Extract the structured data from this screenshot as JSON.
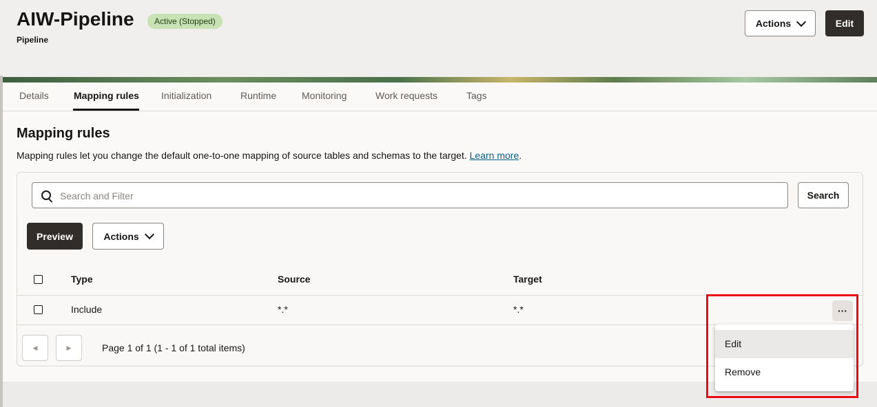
{
  "header": {
    "title": "AIW-Pipeline",
    "status_badge": "Active (Stopped)",
    "subtitle": "Pipeline",
    "actions_label": "Actions",
    "edit_label": "Edit"
  },
  "tabs": [
    {
      "label": "Details"
    },
    {
      "label": "Mapping rules",
      "active": true
    },
    {
      "label": "Initialization"
    },
    {
      "label": "Runtime"
    },
    {
      "label": "Monitoring"
    },
    {
      "label": "Work requests"
    },
    {
      "label": "Tags"
    }
  ],
  "section": {
    "title": "Mapping rules",
    "description": "Mapping rules let you change the default one-to-one mapping of source tables and schemas to the target.",
    "learn_more": "Learn more"
  },
  "search": {
    "placeholder": "Search and Filter",
    "button_label": "Search"
  },
  "toolbar": {
    "preview_label": "Preview",
    "actions_label": "Actions"
  },
  "table": {
    "columns": [
      "Type",
      "Source",
      "Target"
    ],
    "rows": [
      {
        "type": "Include",
        "source": "*.*",
        "target": "*.*"
      }
    ]
  },
  "row_menu": {
    "more_label": "···",
    "items": [
      "Edit",
      "Remove"
    ]
  },
  "pagination": {
    "text": "Page 1 of 1 (1 - 1 of 1 total items)"
  },
  "colors": {
    "accent_dark": "#312d2a",
    "badge_bg": "#c9e2b4",
    "link": "#036085",
    "highlight": "#ee0a14"
  }
}
